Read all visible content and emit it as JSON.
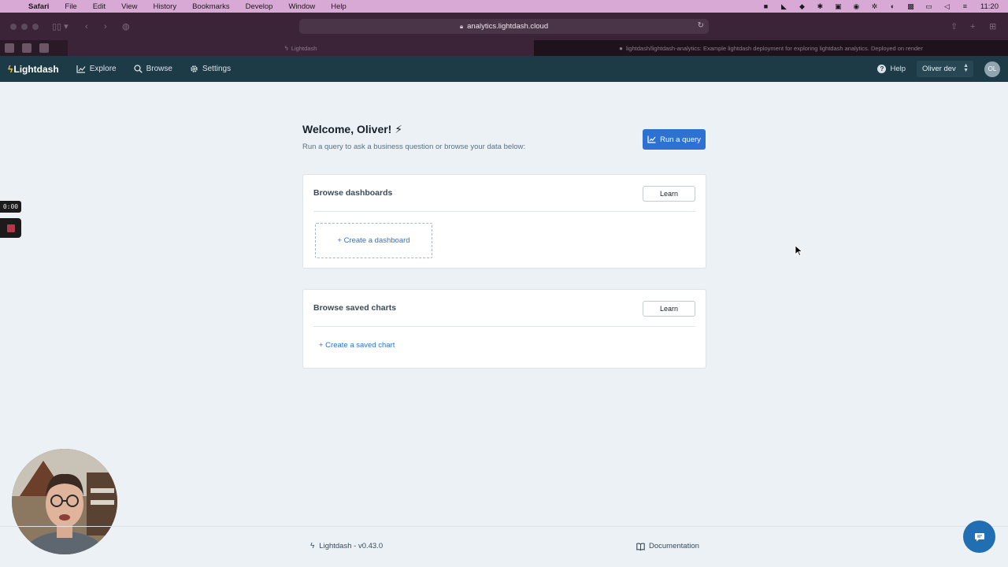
{
  "menubar": {
    "items": [
      "Safari",
      "File",
      "Edit",
      "View",
      "History",
      "Bookmarks",
      "Develop",
      "Window",
      "Help"
    ],
    "clock": "11:20"
  },
  "browser": {
    "url": "analytics.lightdash.cloud",
    "tabs": [
      {
        "title": "Lightdash"
      },
      {
        "title": "lightdash/lightdash-analytics: Example lightdash deployment for exploring lightdash analytics. Deployed on render"
      }
    ]
  },
  "navbar": {
    "brand": "Lightdash",
    "items": [
      {
        "label": "Explore",
        "icon": "chart-icon"
      },
      {
        "label": "Browse",
        "icon": "search-icon"
      },
      {
        "label": "Settings",
        "icon": "gear-icon"
      }
    ],
    "help": "Help",
    "project": "Oliver dev",
    "avatar_initials": "OL"
  },
  "home": {
    "welcome_title": "Welcome, Oliver! ⚡",
    "welcome_subtitle": "Run a query to ask a business question or browse your data below:",
    "run_query_label": "Run a query",
    "dashboards_card": {
      "title": "Browse dashboards",
      "learn_label": "Learn",
      "create_label": "+ Create a dashboard"
    },
    "charts_card": {
      "title": "Browse saved charts",
      "learn_label": "Learn",
      "create_label": "+ Create a saved chart"
    }
  },
  "recording": {
    "timer": "0:00"
  },
  "footer": {
    "version": "Lightdash - v0.43.0",
    "docs_label": "Documentation"
  },
  "colors": {
    "navbar_bg": "#1d3a47",
    "primary": "#2d72d2",
    "page_bg": "#ebf1f5",
    "menubar_bg": "#d9a9d6"
  }
}
